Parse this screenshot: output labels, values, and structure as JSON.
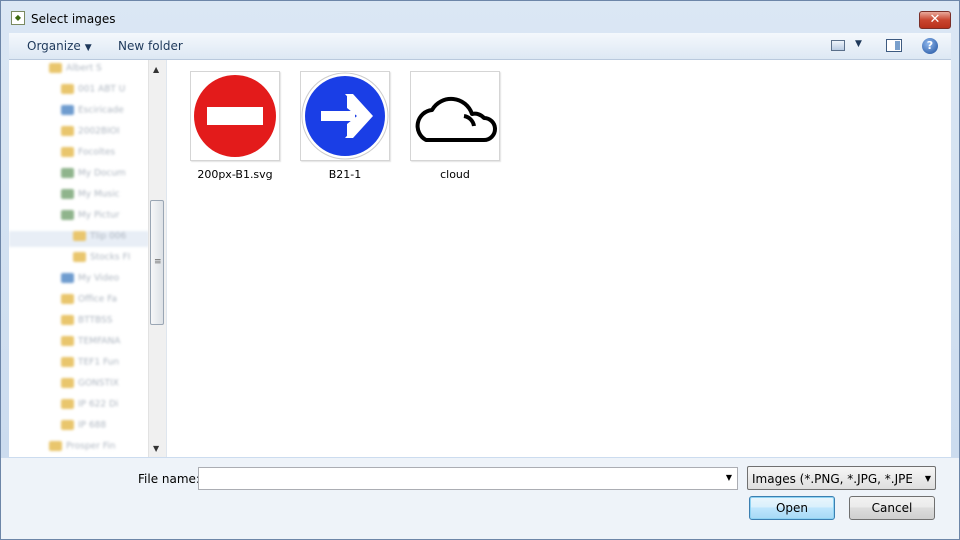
{
  "window": {
    "title": "Select images",
    "close_label": "✕"
  },
  "toolbar": {
    "organize_label": "Organize",
    "new_folder_label": "New folder"
  },
  "nav_tree": {
    "rows": [
      {
        "label": "Albert S",
        "indent": 1,
        "type": "folder"
      },
      {
        "label": "001 ABT U",
        "indent": 2,
        "type": "folder"
      },
      {
        "label": "Esciricade",
        "indent": 2,
        "type": "blue"
      },
      {
        "label": "2002BIOI",
        "indent": 2,
        "type": "folder"
      },
      {
        "label": "Focoltes",
        "indent": 2,
        "type": "folder"
      },
      {
        "label": "My Docum",
        "indent": 2,
        "type": "green"
      },
      {
        "label": "My Music",
        "indent": 2,
        "type": "green"
      },
      {
        "label": "My Pictur",
        "indent": 2,
        "type": "green"
      },
      {
        "label": "Tlip 006",
        "indent": 3,
        "type": "folder",
        "selected": true
      },
      {
        "label": "Stocks FI",
        "indent": 3,
        "type": "folder"
      },
      {
        "label": "My Video",
        "indent": 2,
        "type": "blue"
      },
      {
        "label": "Office Fa",
        "indent": 2,
        "type": "folder"
      },
      {
        "label": "BTTBSS",
        "indent": 2,
        "type": "folder"
      },
      {
        "label": "TEMFANA",
        "indent": 2,
        "type": "folder"
      },
      {
        "label": "TEF1 Fun",
        "indent": 2,
        "type": "folder"
      },
      {
        "label": "GONSTIX",
        "indent": 2,
        "type": "folder"
      },
      {
        "label": "IP 622 Di",
        "indent": 2,
        "type": "folder"
      },
      {
        "label": "IP 688",
        "indent": 2,
        "type": "folder"
      },
      {
        "label": "Prosper Fin",
        "indent": 1,
        "type": "folder"
      }
    ]
  },
  "files": [
    {
      "name": "200px-B1.svg",
      "icon": "no-entry-sign"
    },
    {
      "name": "B21-1",
      "icon": "right-arrow-sign"
    },
    {
      "name": "cloud",
      "icon": "cloud-outline"
    }
  ],
  "bottom": {
    "file_name_label": "File name:",
    "file_name_value": "",
    "file_type_value": "Images (*.PNG, *.JPG, *.JPEG, *.",
    "open_label": "Open",
    "cancel_label": "Cancel"
  },
  "colors": {
    "no_entry_red": "#e31b1b",
    "arrow_blue": "#1a3ee6"
  }
}
